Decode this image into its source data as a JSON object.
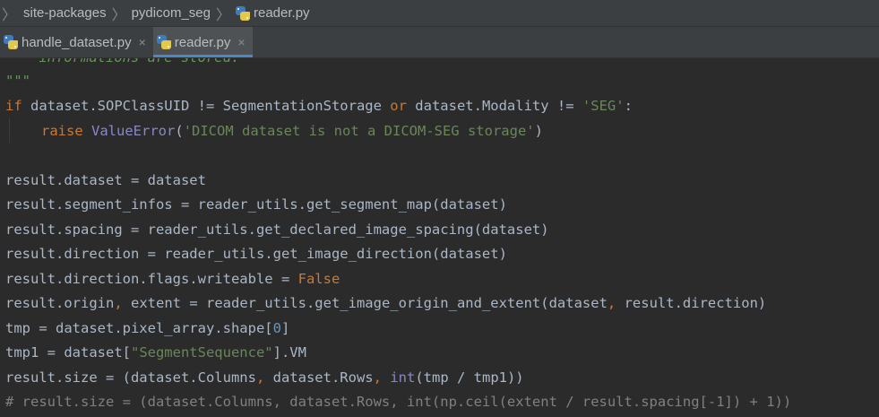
{
  "breadcrumb": {
    "items": [
      "site-packages",
      "pydicom_seg",
      "reader.py"
    ]
  },
  "tabs": [
    {
      "label": "handle_dataset.py",
      "close": "×",
      "active": false
    },
    {
      "label": "reader.py",
      "close": "×",
      "active": true
    }
  ],
  "code": {
    "l0": "    informations are stored.",
    "l1": "\"\"\"",
    "l2": {
      "kw_if": "if",
      "a": " dataset.SOPClassUID != SegmentationStorage ",
      "kw_or": "or",
      "b": " dataset.Modality != ",
      "str": "'SEG'",
      "c": ":"
    },
    "l3": {
      "kw_raise": "raise",
      "sp": " ",
      "bi": "ValueError",
      "p1": "(",
      "str": "'DICOM dataset is not a DICOM-SEG storage'",
      "p2": ")"
    },
    "l5": "result.dataset = dataset",
    "l6": "result.segment_infos = reader_utils.get_segment_map(dataset)",
    "l7": "result.spacing = reader_utils.get_declared_image_spacing(dataset)",
    "l8": "result.direction = reader_utils.get_image_direction(dataset)",
    "l9": {
      "a": "result.direction.flags.writeable = ",
      "kw": "False"
    },
    "l10": {
      "a": "result.origin",
      "comma": ",",
      "b": " extent = reader_utils.get_image_origin_and_extent(dataset",
      "comma2": ",",
      "c": " result.direction)"
    },
    "l11": {
      "a": "tmp = dataset.pixel_array.shape[",
      "num": "0",
      "b": "]"
    },
    "l12": {
      "a": "tmp1 = dataset[",
      "str": "\"SegmentSequence\"",
      "b": "].VM"
    },
    "l13": {
      "a": "result.size = (dataset.Columns",
      "comma": ",",
      "b": " dataset.Rows",
      "comma2": ",",
      "c": " ",
      "bi": "int",
      "d": "(tmp / tmp1))"
    },
    "l14": "# result.size = (dataset.Columns, dataset.Rows, int(np.ceil(extent / result.spacing[-1]) + 1))"
  },
  "colors": {
    "keyword": "#cc7832",
    "string": "#6a8759",
    "number": "#6897bb",
    "builtin": "#8888c6",
    "comment": "#808080",
    "text": "#a9b7c6",
    "tab_underline": "#4a88c7"
  }
}
